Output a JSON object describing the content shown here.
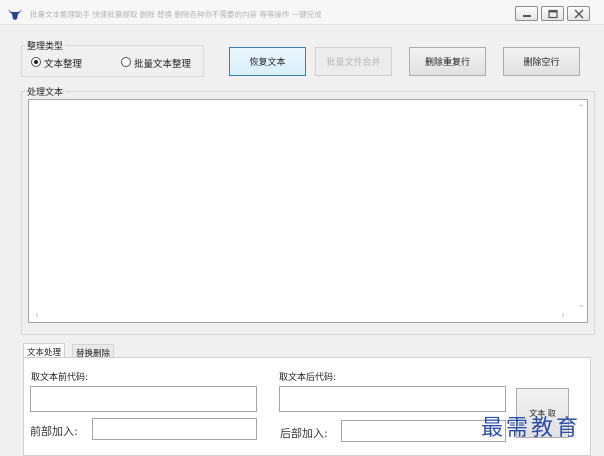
{
  "window": {
    "title": "批量文本整理助手  快速批量提取 删除  替换 删除各种你不需要的内容 等等操作 一键完成",
    "controls": {
      "minimize": "minimize-icon",
      "restore": "restore-icon",
      "close": "close-icon"
    }
  },
  "organize_type": {
    "title": "整理类型",
    "options": [
      {
        "label": "文本整理",
        "selected": true
      },
      {
        "label": "批量文本整理",
        "selected": false
      }
    ]
  },
  "toolbar": {
    "restore_text": "恢复文本",
    "merge_files": "批量文件合并",
    "delete_duplicate_lines": "删除重复行",
    "delete_empty_lines": "删除空行"
  },
  "processing": {
    "title": "处理文本",
    "text": ""
  },
  "tabs": [
    {
      "label": "文本处理",
      "active": true
    },
    {
      "label": "替换删除",
      "active": false
    }
  ],
  "text_tab": {
    "prefix_code_label": "取文本前代码:",
    "suffix_code_label": "取文本后代码:",
    "front_add_label": "前部加入:",
    "back_add_label": "后部加入:",
    "extract_button": "文本 取"
  },
  "watermark": "最需教育",
  "colors": {
    "accent_border": "#3c7fb1",
    "watermark": "#2e4fa7",
    "window_bg": "#f0f0f0"
  }
}
